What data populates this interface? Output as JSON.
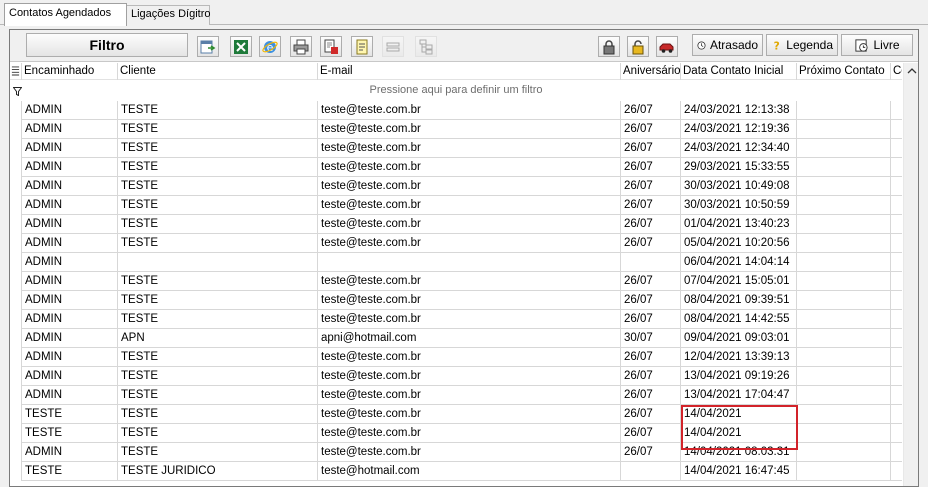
{
  "tabs": [
    {
      "label": "Contatos Agendados"
    },
    {
      "label": "Ligações Dígitro"
    }
  ],
  "toolbar": {
    "filtro_label": "Filtro",
    "atrasado_label": "Atrasado",
    "legenda_label": "Legenda",
    "livre_label": "Livre",
    "icons": [
      "export-icon",
      "excel-icon",
      "internet-explorer-icon",
      "print-icon",
      "print-preview-icon",
      "document-icon",
      "row-icon",
      "tree-icon",
      "lock-closed-icon",
      "lock-open-icon",
      "car-icon"
    ]
  },
  "grid": {
    "columns": [
      "Encaminhado",
      "Cliente",
      "E-mail",
      "Aniversário",
      "Data Contato Inicial",
      "Próximo Contato",
      "Co"
    ],
    "filter_hint": "Pressione aqui para definir um filtro",
    "rows": [
      [
        "ADMIN",
        "TESTE",
        "teste@teste.com.br",
        "26/07",
        "24/03/2021 12:13:38"
      ],
      [
        "ADMIN",
        "TESTE",
        "teste@teste.com.br",
        "26/07",
        "24/03/2021 12:19:36"
      ],
      [
        "ADMIN",
        "TESTE",
        "teste@teste.com.br",
        "26/07",
        "24/03/2021 12:34:40"
      ],
      [
        "ADMIN",
        "TESTE",
        "teste@teste.com.br",
        "26/07",
        "29/03/2021 15:33:55"
      ],
      [
        "ADMIN",
        "TESTE",
        "teste@teste.com.br",
        "26/07",
        "30/03/2021 10:49:08"
      ],
      [
        "ADMIN",
        "TESTE",
        "teste@teste.com.br",
        "26/07",
        "30/03/2021 10:50:59"
      ],
      [
        "ADMIN",
        "TESTE",
        "teste@teste.com.br",
        "26/07",
        "01/04/2021 13:40:23"
      ],
      [
        "ADMIN",
        "TESTE",
        "teste@teste.com.br",
        "26/07",
        "05/04/2021 10:20:56"
      ],
      [
        "ADMIN",
        "",
        "",
        "",
        "06/04/2021 14:04:14"
      ],
      [
        "ADMIN",
        "TESTE",
        "teste@teste.com.br",
        "26/07",
        "07/04/2021 15:05:01"
      ],
      [
        "ADMIN",
        "TESTE",
        "teste@teste.com.br",
        "26/07",
        "08/04/2021 09:39:51"
      ],
      [
        "ADMIN",
        "TESTE",
        "teste@teste.com.br",
        "26/07",
        "08/04/2021 14:42:55"
      ],
      [
        "ADMIN",
        "APN",
        "apni@hotmail.com",
        "30/07",
        "09/04/2021 09:03:01"
      ],
      [
        "ADMIN",
        "TESTE",
        "teste@teste.com.br",
        "26/07",
        "12/04/2021 13:39:13"
      ],
      [
        "ADMIN",
        "TESTE",
        "teste@teste.com.br",
        "26/07",
        "13/04/2021 09:19:26"
      ],
      [
        "ADMIN",
        "TESTE",
        "teste@teste.com.br",
        "26/07",
        "13/04/2021 17:04:47"
      ],
      [
        "TESTE",
        "TESTE",
        "teste@teste.com.br",
        "26/07",
        "14/04/2021"
      ],
      [
        "TESTE",
        "TESTE",
        "teste@teste.com.br",
        "26/07",
        "14/04/2021"
      ],
      [
        "ADMIN",
        "TESTE",
        "teste@teste.com.br",
        "26/07",
        "14/04/2021 08:03:31"
      ],
      [
        "TESTE",
        "TESTE JURIDICO",
        "teste@hotmail.com",
        "",
        "14/04/2021 16:47:45"
      ]
    ]
  },
  "colors": {
    "highlight": "#d2232a",
    "grid_line": "#d7d7d7"
  }
}
